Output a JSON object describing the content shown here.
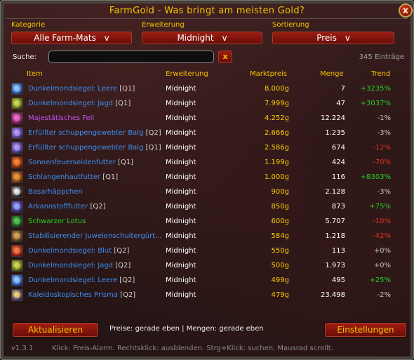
{
  "window": {
    "title": "FarmGold - Was bringt am meisten Gold?",
    "close_glyph": "x"
  },
  "filters": {
    "category": {
      "label": "Kategorie",
      "value": "Alle Farm-Mats",
      "chevron": "v"
    },
    "expansion": {
      "label": "Erweiterung",
      "value": "Midnight",
      "chevron": "v"
    },
    "sort": {
      "label": "Sortierung",
      "value": "Preis",
      "chevron": "v"
    }
  },
  "search": {
    "label": "Suche:",
    "value": "",
    "clear_label": "x",
    "count": "345 Einträge"
  },
  "table": {
    "headers": {
      "item": "Item",
      "expansion": "Erweiterung",
      "price": "Marktpreis",
      "qty": "Menge",
      "trend": "Trend"
    },
    "rows": [
      {
        "name": "Dunkelmondsiegel: Leere",
        "tier": "[Q1]",
        "expansion": "Midnight",
        "price": "8.000",
        "unit": "g",
        "qty": "7",
        "trend": "+3235%",
        "name_color": "#3a8ff0",
        "trend_color": "#22d022",
        "icon": "seal-void-icon",
        "icon_bg": "#2a4aa0",
        "icon_fg": "#9ad4ff"
      },
      {
        "name": "Dunkelmondsiegel: Jagd",
        "tier": "[Q1]",
        "expansion": "Midnight",
        "price": "7.999",
        "unit": "g",
        "qty": "47",
        "trend": "+3037%",
        "name_color": "#3a8ff0",
        "trend_color": "#22d022",
        "icon": "seal-hunt-icon",
        "icon_bg": "#5a6a18",
        "icon_fg": "#d8e060"
      },
      {
        "name": "Majestätisches Fell",
        "tier": "",
        "expansion": "Midnight",
        "price": "4.252",
        "unit": "g",
        "qty": "12.224",
        "trend": "-1%",
        "name_color": "#c050f0",
        "trend_color": "#c8c8c8",
        "icon": "fur-icon",
        "icon_bg": "#7a1a5a",
        "icon_fg": "#f07ad0"
      },
      {
        "name": "Erfüllter schuppengewebter Balg",
        "tier": "[Q2]",
        "expansion": "Midnight",
        "price": "2.666",
        "unit": "g",
        "qty": "1.235",
        "trend": "-3%",
        "name_color": "#3a8ff0",
        "trend_color": "#c8c8c8",
        "icon": "hide-icon",
        "icon_bg": "#4a3a8a",
        "icon_fg": "#c0a0ff"
      },
      {
        "name": "Erfüllter schuppengewebter Balg",
        "tier": "[Q1]",
        "expansion": "Midnight",
        "price": "2.586",
        "unit": "g",
        "qty": "674",
        "trend": "-12%",
        "name_color": "#3a8ff0",
        "trend_color": "#e03020",
        "icon": "hide-icon",
        "icon_bg": "#4a3a8a",
        "icon_fg": "#c0a0ff"
      },
      {
        "name": "Sonnenfeuerseidenfutter",
        "tier": "[Q1]",
        "expansion": "Midnight",
        "price": "1.199",
        "unit": "g",
        "qty": "424",
        "trend": "-70%",
        "name_color": "#3a8ff0",
        "trend_color": "#e03020",
        "icon": "silk-icon",
        "icon_bg": "#8a2a10",
        "icon_fg": "#ff9040"
      },
      {
        "name": "Schlangenhautfutter",
        "tier": "[Q1]",
        "expansion": "Midnight",
        "price": "1.000",
        "unit": "g",
        "qty": "116",
        "trend": "+8303%",
        "name_color": "#3a8ff0",
        "trend_color": "#22d022",
        "icon": "snakeskin-icon",
        "icon_bg": "#7a3a10",
        "icon_fg": "#f0a040"
      },
      {
        "name": "Basarhäppchen",
        "tier": "",
        "expansion": "Midnight",
        "price": "900",
        "unit": "g",
        "qty": "2.128",
        "trend": "-3%",
        "name_color": "#3a8ff0",
        "trend_color": "#c8c8c8",
        "icon": "snack-icon",
        "icon_bg": "#2a2a2a",
        "icon_fg": "#ffffff"
      },
      {
        "name": "Arkanostofffutter",
        "tier": "[Q2]",
        "expansion": "Midnight",
        "price": "850",
        "unit": "g",
        "qty": "873",
        "trend": "+75%",
        "name_color": "#3a8ff0",
        "trend_color": "#22d022",
        "icon": "arcane-cloth-icon",
        "icon_bg": "#3a2a8a",
        "icon_fg": "#a0b0ff"
      },
      {
        "name": "Schwarzer Lotus",
        "tier": "",
        "expansion": "Midnight",
        "price": "600",
        "unit": "g",
        "qty": "5.707",
        "trend": "-10%",
        "name_color": "#22d022",
        "trend_color": "#e03020",
        "icon": "lotus-icon",
        "icon_bg": "#1a4a1a",
        "icon_fg": "#60d060"
      },
      {
        "name": "Stabilisierender Juwelenschuitergürt...",
        "tier": "",
        "expansion": "Midnight",
        "price": "584",
        "unit": "g",
        "qty": "1.218",
        "trend": "-42%",
        "name_color": "#3a8ff0",
        "trend_color": "#e03020",
        "icon": "belt-icon",
        "icon_bg": "#5a3a20",
        "icon_fg": "#e0b060"
      },
      {
        "name": "Dunkelmondsiegel: Blut",
        "tier": "[Q2]",
        "expansion": "Midnight",
        "price": "550",
        "unit": "g",
        "qty": "113",
        "trend": "+0%",
        "name_color": "#3a8ff0",
        "trend_color": "#c8c8c8",
        "icon": "seal-blood-icon",
        "icon_bg": "#8a2010",
        "icon_fg": "#ff8050"
      },
      {
        "name": "Dunkelmondsiegel: Jagd",
        "tier": "[Q2]",
        "expansion": "Midnight",
        "price": "500",
        "unit": "g",
        "qty": "1.973",
        "trend": "+0%",
        "name_color": "#3a8ff0",
        "trend_color": "#c8c8c8",
        "icon": "seal-hunt-icon",
        "icon_bg": "#5a6a18",
        "icon_fg": "#d8e060"
      },
      {
        "name": "Dunkelmondsiegel: Leere",
        "tier": "[Q2]",
        "expansion": "Midnight",
        "price": "499",
        "unit": "g",
        "qty": "495",
        "trend": "+25%",
        "name_color": "#3a8ff0",
        "trend_color": "#22d022",
        "icon": "seal-void-icon",
        "icon_bg": "#2a4aa0",
        "icon_fg": "#9ad4ff"
      },
      {
        "name": "Kaleidoskopisches Prisma",
        "tier": "[Q2]",
        "expansion": "Midnight",
        "price": "479",
        "unit": "g",
        "qty": "23.498",
        "trend": "-2%",
        "name_color": "#3a8ff0",
        "trend_color": "#c8c8c8",
        "icon": "prism-icon",
        "icon_bg": "#4a3a6a",
        "icon_fg": "#ffe070"
      }
    ]
  },
  "footer": {
    "refresh_label": "Aktualisieren",
    "status": "Preise: gerade eben  |  Mengen: gerade eben",
    "settings_label": "Einstellungen",
    "version": "v1.3.1",
    "hint": "Klick: Preis-Alarm. Rechtsklick: ausblenden. Strg+Klick: suchen. Mausrad scrollt."
  },
  "colors": {
    "gold": "#f0c400",
    "button_red": "#8a1810",
    "link_blue": "#3a8ff0",
    "trend_up": "#22d022",
    "trend_down": "#e03020"
  }
}
